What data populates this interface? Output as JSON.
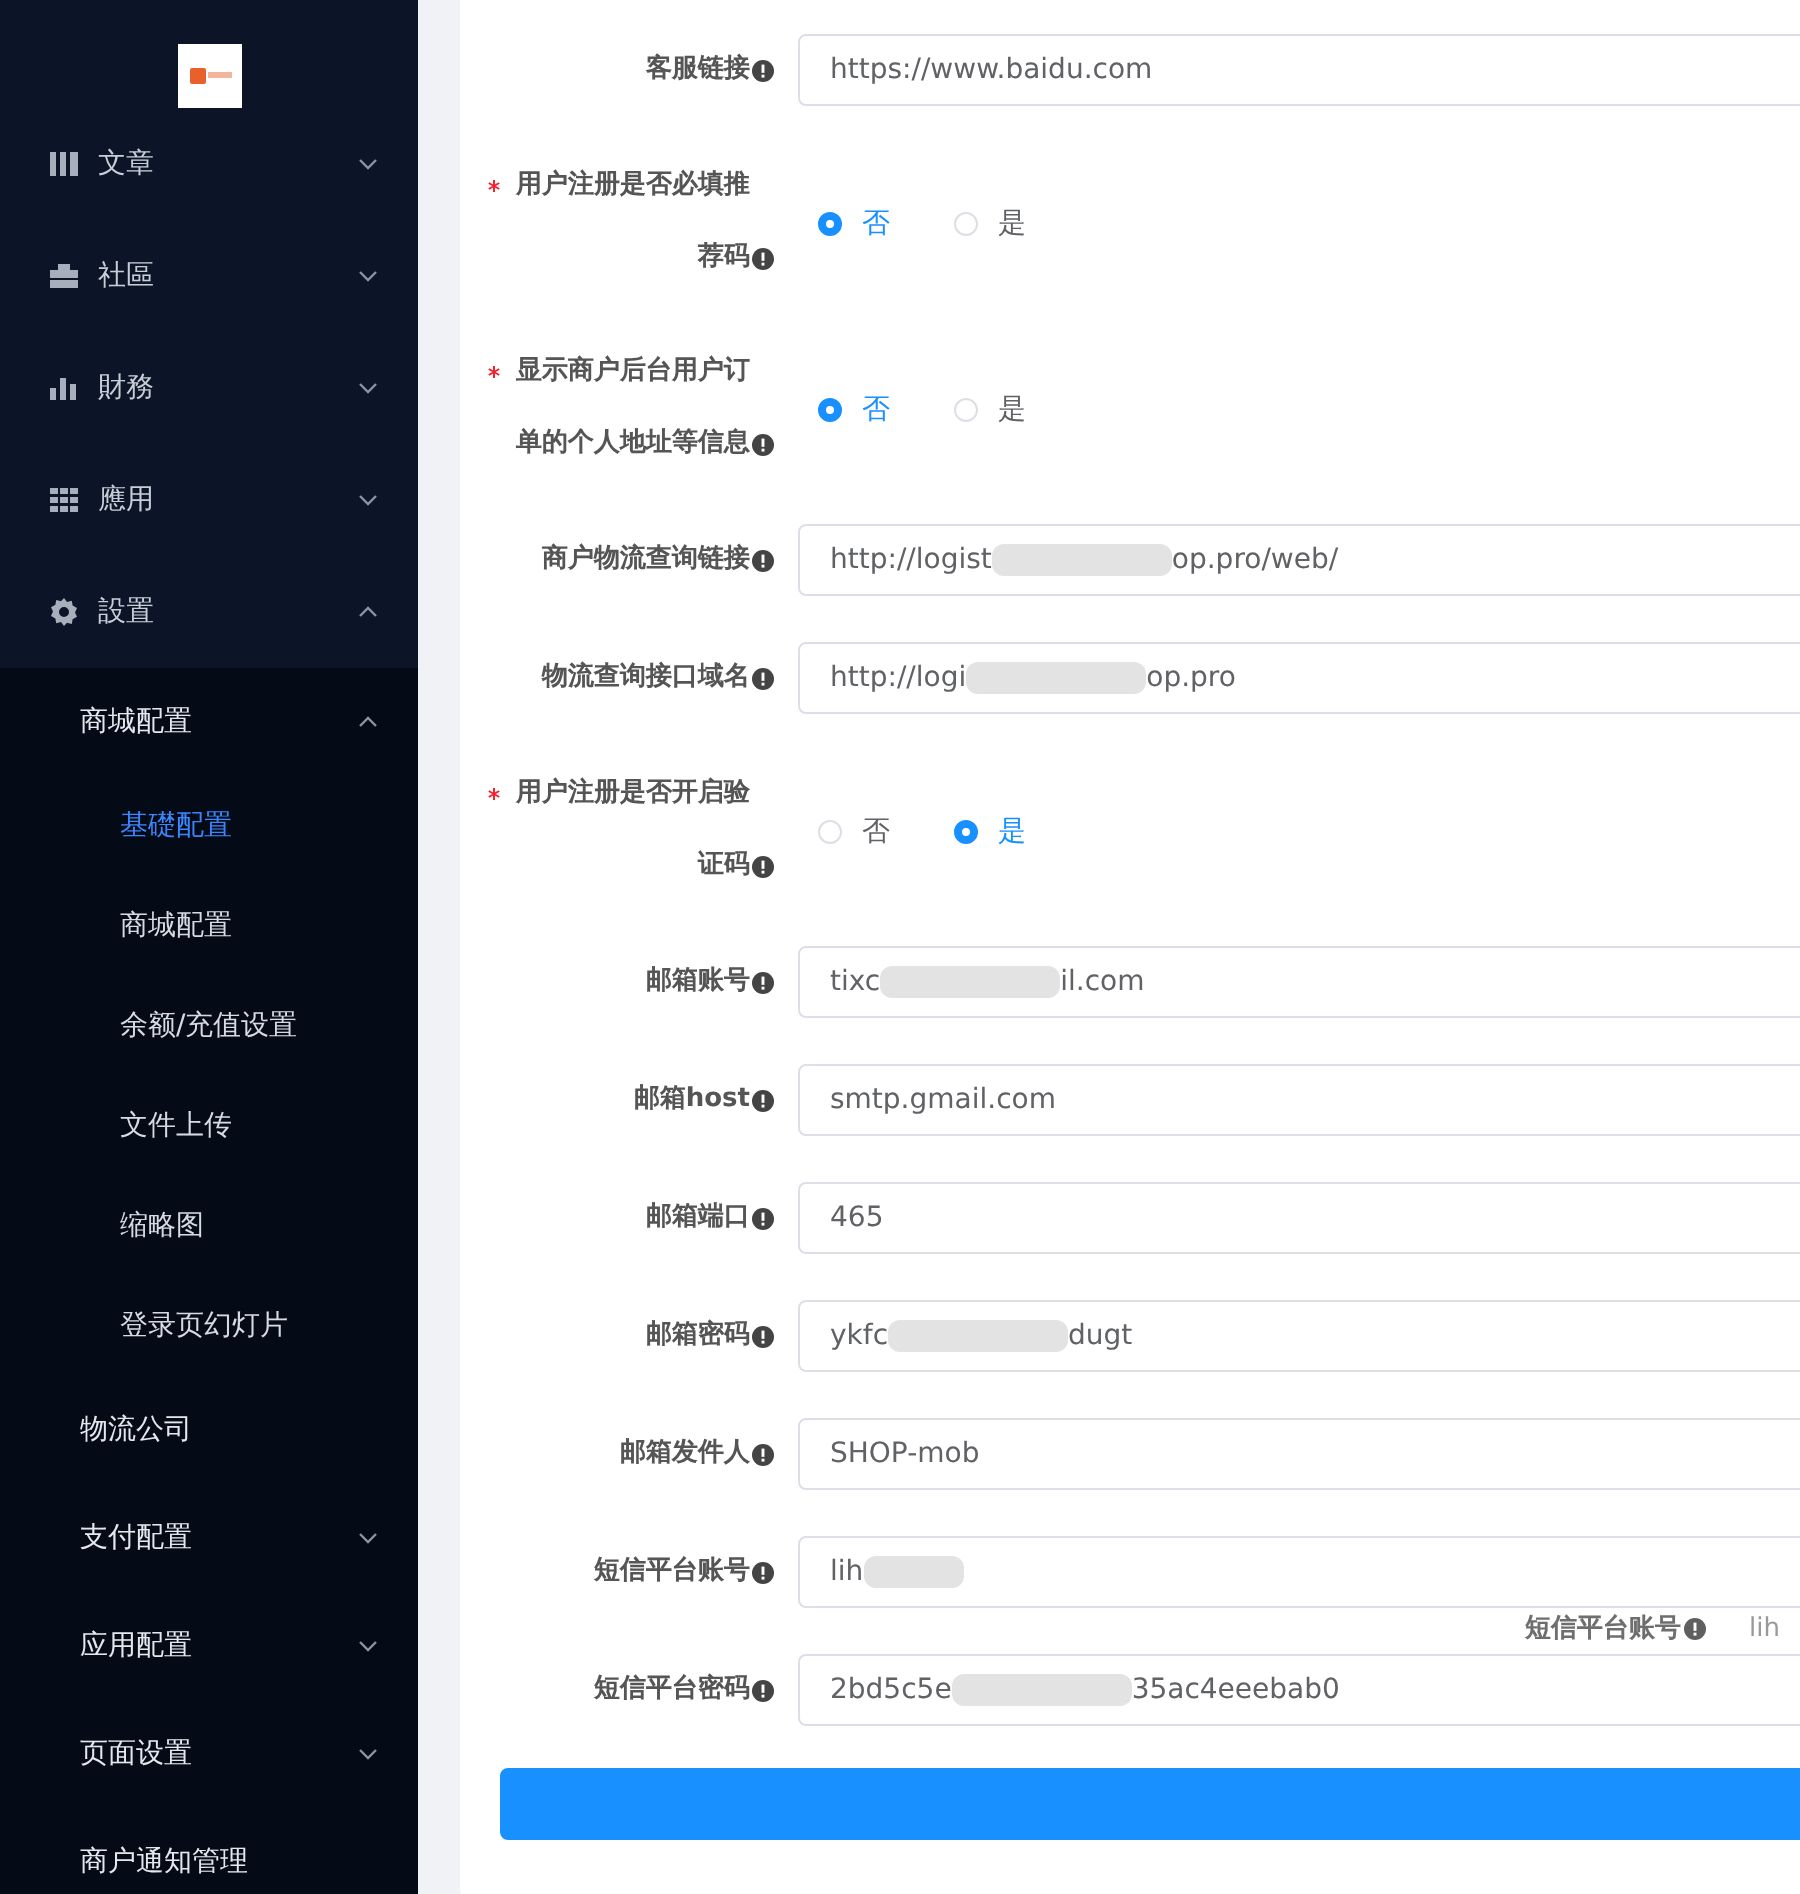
{
  "sidebar": {
    "items": [
      {
        "label": "文章",
        "expanded": false
      },
      {
        "label": "社區",
        "expanded": false
      },
      {
        "label": "財務",
        "expanded": false
      },
      {
        "label": "應用",
        "expanded": false
      },
      {
        "label": "設置",
        "expanded": true,
        "children": [
          {
            "label": "商城配置",
            "expanded": true,
            "children": [
              {
                "label": "基礎配置",
                "selected": true
              },
              {
                "label": "商城配置",
                "selected": false
              },
              {
                "label": "余额/充值设置",
                "selected": false
              },
              {
                "label": "文件上传",
                "selected": false
              },
              {
                "label": "缩略图",
                "selected": false
              },
              {
                "label": "登录页幻灯片",
                "selected": false
              }
            ]
          },
          {
            "label": "物流公司"
          },
          {
            "label": "支付配置",
            "expanded": false
          },
          {
            "label": "应用配置",
            "expanded": false
          },
          {
            "label": "页面设置",
            "expanded": false
          },
          {
            "label": "商户通知管理"
          }
        ]
      }
    ]
  },
  "form": {
    "fields": [
      {
        "kind": "text",
        "label": "客服链接",
        "required": false,
        "value_parts": [
          "https://www.baidu.com"
        ]
      },
      {
        "kind": "radio",
        "label": "用户注册是否必填推荐码",
        "required": true,
        "options": [
          {
            "label": "否",
            "selected": true
          },
          {
            "label": "是",
            "selected": false
          }
        ]
      },
      {
        "kind": "radio",
        "label": "显示商户后台用户订单的个人地址等信息",
        "required": true,
        "options": [
          {
            "label": "否",
            "selected": true
          },
          {
            "label": "是",
            "selected": false
          }
        ]
      },
      {
        "kind": "text",
        "label": "商户物流查询链接",
        "required": false,
        "value_parts": [
          "http://logist",
          "op.pro/web/"
        ]
      },
      {
        "kind": "text",
        "label": "物流查询接口域名",
        "required": false,
        "value_parts": [
          "http://logi",
          "op.pro"
        ]
      },
      {
        "kind": "radio",
        "label": "用户注册是否开启验证码",
        "required": true,
        "options": [
          {
            "label": "否",
            "selected": false
          },
          {
            "label": "是",
            "selected": true
          }
        ]
      },
      {
        "kind": "text",
        "label": "邮箱账号",
        "required": false,
        "value_parts": [
          "tixc",
          "il.com"
        ]
      },
      {
        "kind": "text",
        "label": "邮箱host",
        "required": false,
        "value_parts": [
          "smtp.gmail.com"
        ]
      },
      {
        "kind": "text",
        "label": "邮箱端口",
        "required": false,
        "value_parts": [
          "465"
        ]
      },
      {
        "kind": "text",
        "label": "邮箱密码",
        "required": false,
        "value_parts": [
          "ykfc",
          "dugt"
        ]
      },
      {
        "kind": "text",
        "label": "邮箱发件人",
        "required": false,
        "value_parts": [
          "SHOP-mob"
        ]
      },
      {
        "kind": "text",
        "label": "短信平台账号",
        "required": false,
        "value_parts": [
          "lih"
        ],
        "blurred_end": true
      },
      {
        "kind": "ghost",
        "label": "短信平台账号",
        "value_parts": [
          "lih"
        ]
      },
      {
        "kind": "text",
        "label": "短信平台密码",
        "required": false,
        "value_parts": [
          "2bd5c5e",
          "35ac4eeebab0"
        ]
      }
    ]
  }
}
